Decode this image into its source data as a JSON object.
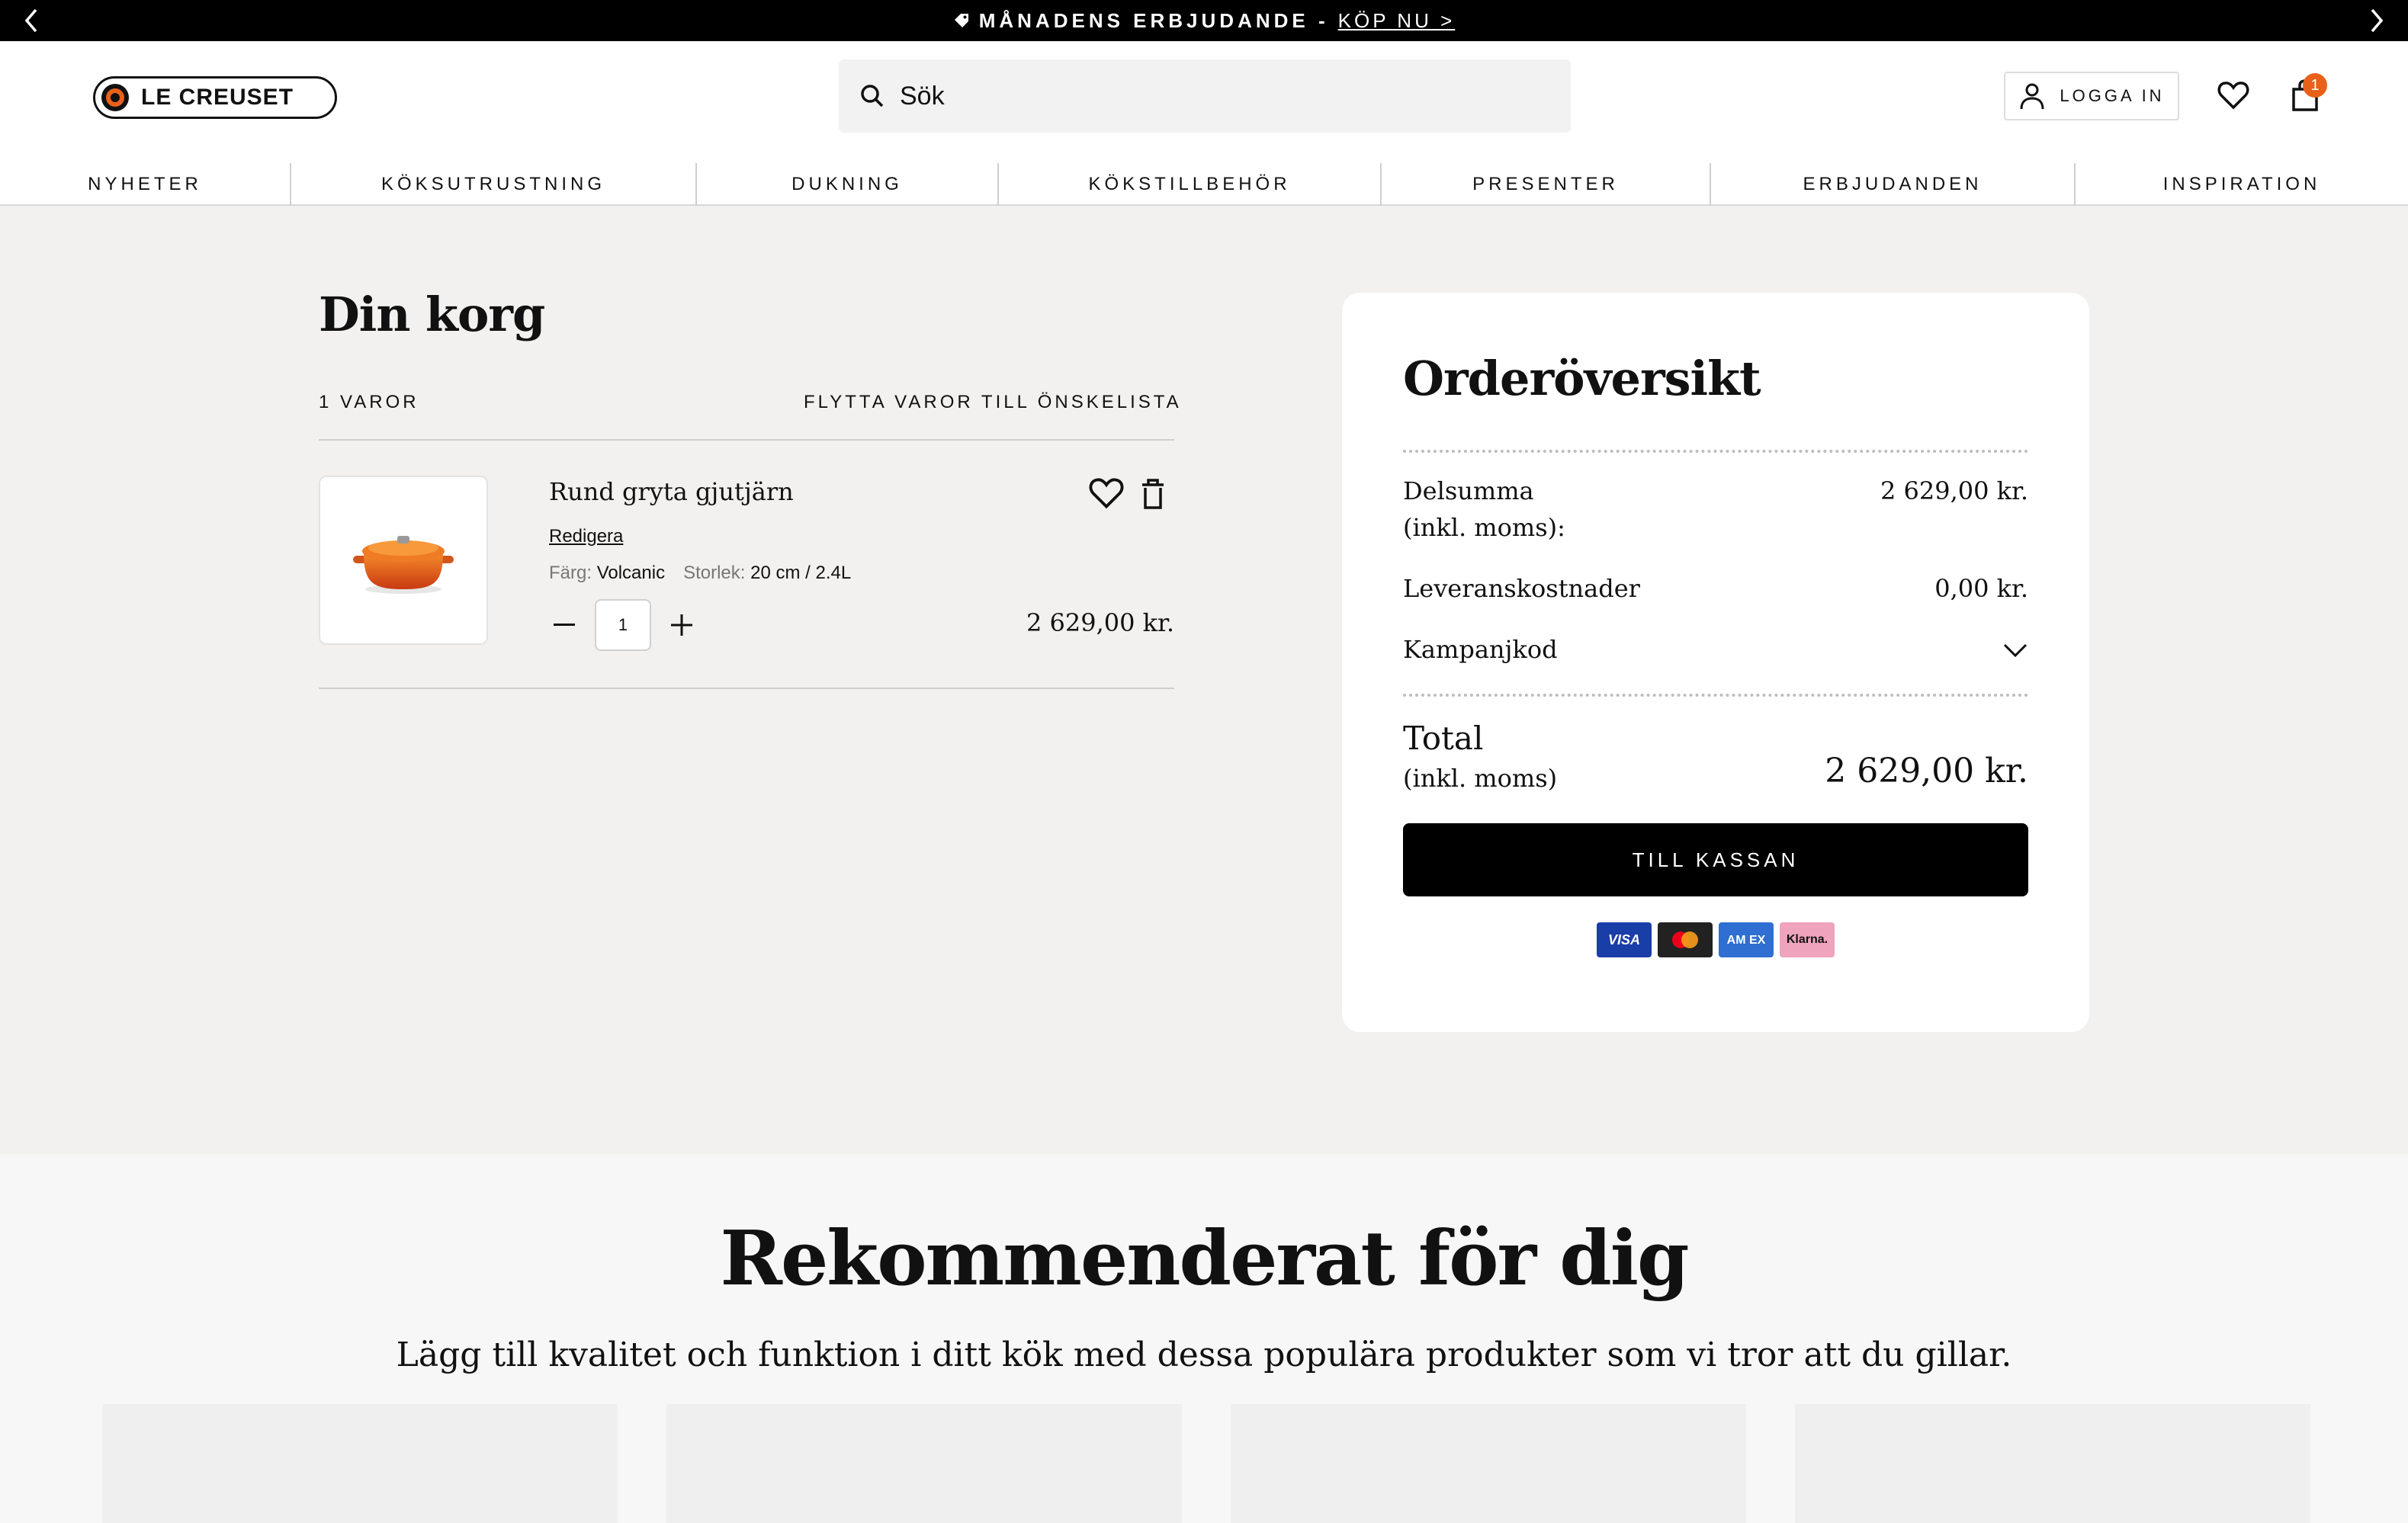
{
  "promo": {
    "message": "MÅNADENS ERBJUDANDE -",
    "cta": "KÖP NU >"
  },
  "header": {
    "logo_text": "LE CREUSET",
    "search_placeholder": "Sök",
    "login_label": "LOGGA IN",
    "cart_count": "1"
  },
  "nav": {
    "items": [
      "NYHETER",
      "KÖKSUTRUSTNING",
      "DUKNING",
      "KÖKSTILLBEHÖR",
      "PRESENTER",
      "ERBJUDANDEN",
      "INSPIRATION"
    ]
  },
  "cart": {
    "title": "Din korg",
    "count_label": "1 VAROR",
    "move_to_wishlist": "FLYTTA VAROR TILL ÖNSKELISTA",
    "items": [
      {
        "name": "Rund gryta gjutjärn",
        "edit_label": "Redigera",
        "color_key": "Färg:",
        "color_value": "Volcanic",
        "size_key": "Storlek:",
        "size_value": "20 cm / 2.4L",
        "quantity": "1",
        "price": "2 629,00 kr."
      }
    ]
  },
  "summary": {
    "title": "Orderöversikt",
    "subtotal_label_1": "Delsumma",
    "subtotal_label_2": "(inkl. moms):",
    "subtotal_value": "2 629,00 kr.",
    "shipping_label": "Leveranskostnader",
    "shipping_value": "0,00 kr.",
    "promo_label": "Kampanjkod",
    "total_label": "Total",
    "total_sub": "(inkl. moms)",
    "total_value": "2 629,00 kr.",
    "checkout_label": "TILL KASSAN",
    "payments": [
      {
        "label": "VISA",
        "bg": "#1a3ea8",
        "fg": "#ffffff"
      },
      {
        "label": "",
        "bg": "#222222",
        "fg": "#ffffff"
      },
      {
        "label": "AM EX",
        "bg": "#2e6fd1",
        "fg": "#ffffff"
      },
      {
        "label": "Klarna.",
        "bg": "#f0a3bc",
        "fg": "#111111"
      }
    ]
  },
  "recommended": {
    "heading": "Rekommenderat för dig",
    "subheading": "Lägg till kvalitet och funktion i ditt kök med dessa populära produkter som vi tror att du gillar."
  },
  "colors": {
    "accent": "#e8611a",
    "background": "#f2f1ef",
    "button": "#000000"
  }
}
